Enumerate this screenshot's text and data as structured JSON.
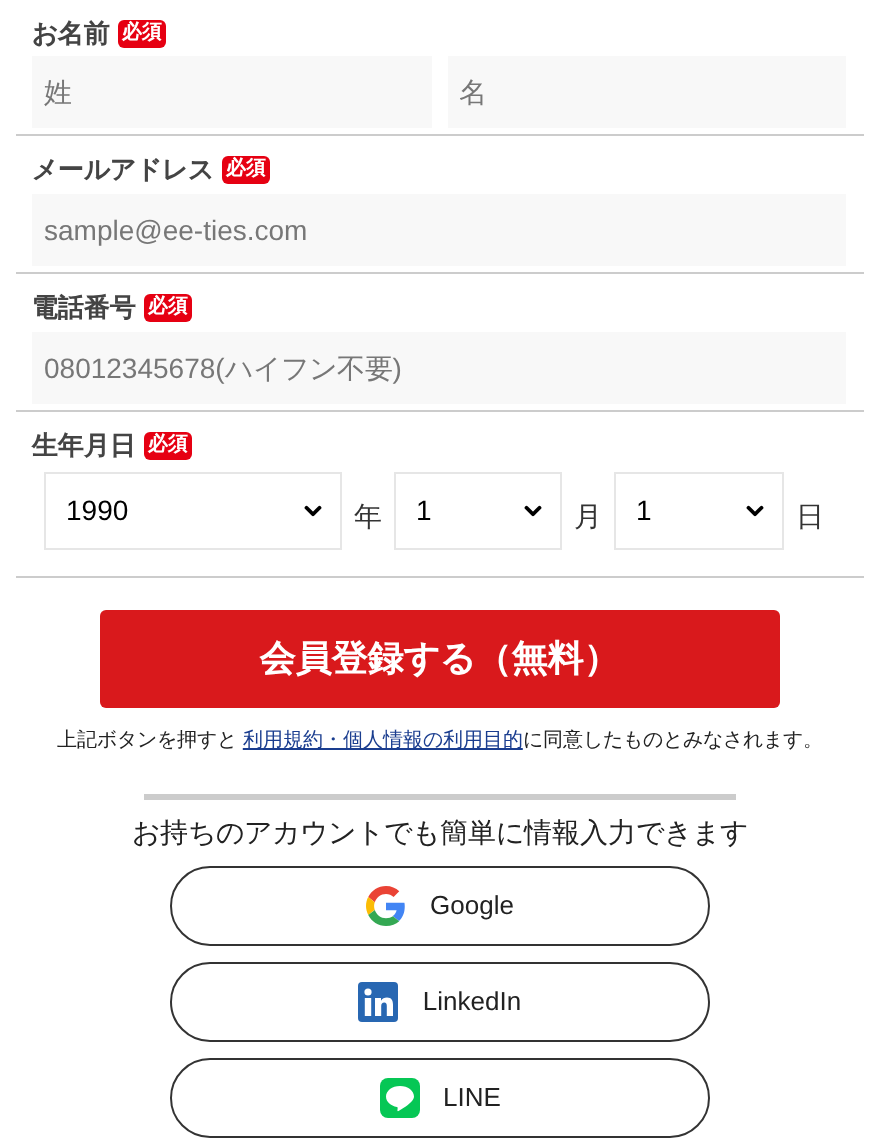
{
  "sections": [
    {
      "kind": "pair",
      "label": "お名前",
      "badge": "必須",
      "fields": [
        {
          "placeholder": "姓"
        },
        {
          "placeholder": "名"
        }
      ]
    },
    {
      "kind": "single",
      "label": "メールアドレス",
      "badge": "必須",
      "fields": [
        {
          "placeholder": "sample@ee-ties.com"
        }
      ]
    },
    {
      "kind": "single",
      "label": "電話番号",
      "badge": "必須",
      "fields": [
        {
          "placeholder": "08012345678(ハイフン不要)"
        }
      ]
    },
    {
      "kind": "date",
      "label": "生年月日",
      "badge": "必須",
      "selects": [
        {
          "value": "1990",
          "unit": "年"
        },
        {
          "value": "1",
          "unit": "月"
        },
        {
          "value": "1",
          "unit": "日"
        }
      ]
    }
  ],
  "submit": "会員登録する（無料）",
  "consent": {
    "before": "上記ボタンを押すと",
    "link": "利用規約・個人情報の利用目的",
    "after": "に同意したものとみなされます。"
  },
  "social_heading": "お持ちのアカウントでも簡単に情報入力できます",
  "social_buttons": [
    {
      "kind": "google",
      "label": "Google"
    },
    {
      "kind": "linkedin",
      "label": "LinkedIn"
    },
    {
      "kind": "line",
      "label": "LINE"
    }
  ]
}
